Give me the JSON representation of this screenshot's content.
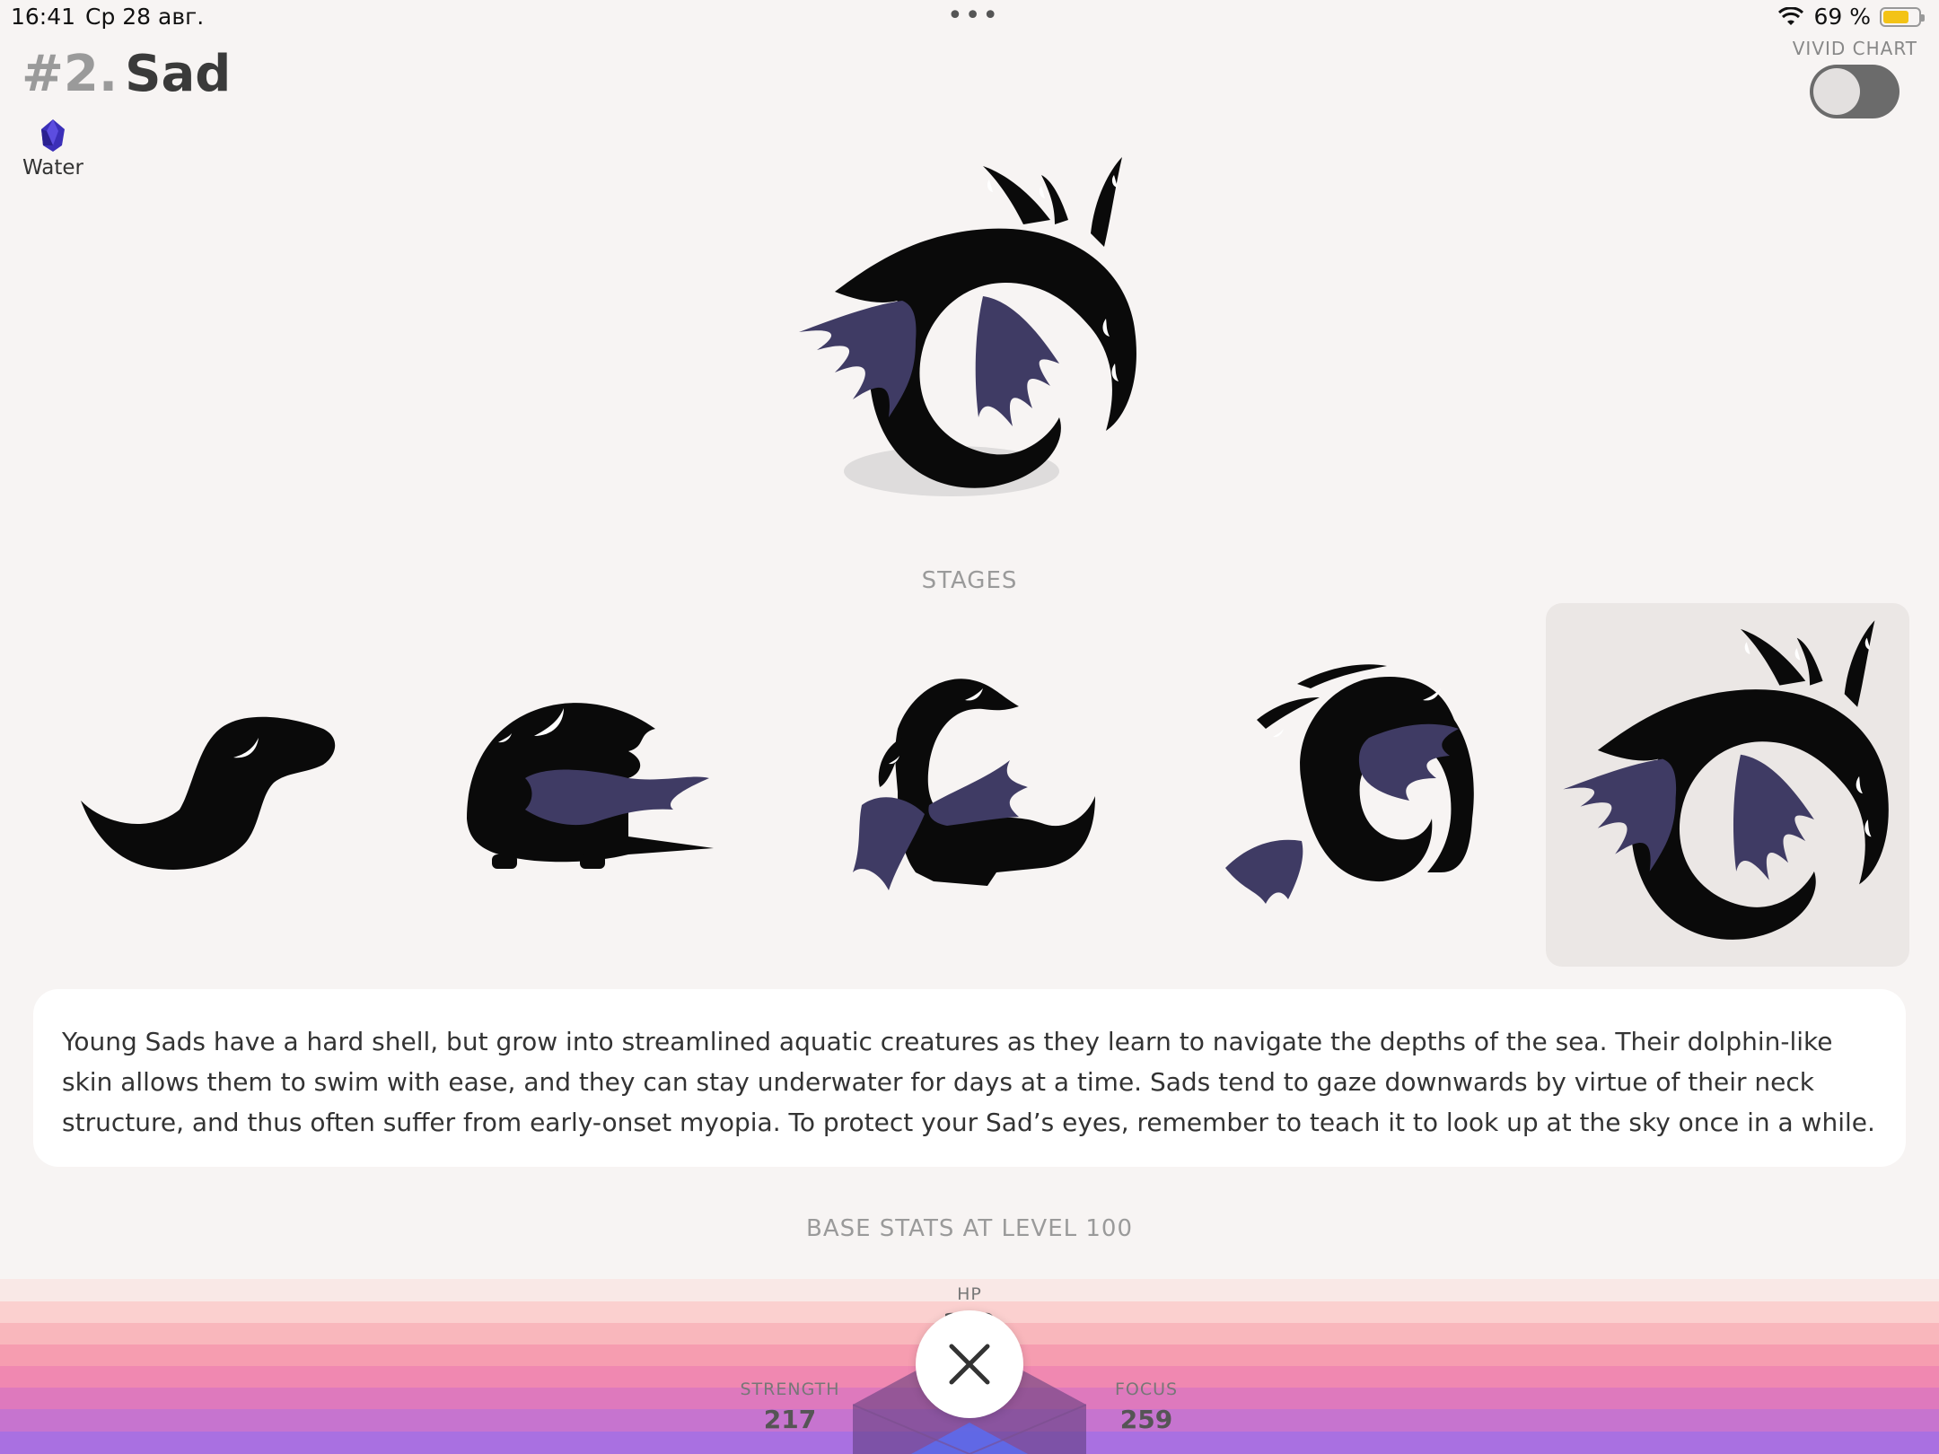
{
  "status": {
    "time": "16:41",
    "date": "Ср 28 авг.",
    "battery": "69 %",
    "dots": "•••"
  },
  "title": {
    "number": "#2.",
    "name": "Sad"
  },
  "element": {
    "label": "Water",
    "icon": "water-gem-icon"
  },
  "vivid_chart": {
    "label": "VIVID CHART",
    "enabled": false
  },
  "stages_label": "STAGES",
  "stages": [
    {
      "name": "stage-1",
      "selected": false
    },
    {
      "name": "stage-2",
      "selected": false
    },
    {
      "name": "stage-3",
      "selected": false
    },
    {
      "name": "stage-4",
      "selected": false
    },
    {
      "name": "stage-5",
      "selected": true
    }
  ],
  "description": "Young Sads have a hard shell, but grow into streamlined aquatic creatures as they learn to navigate the depths of the sea. Their dolphin-like skin allows them to swim with ease, and they can stay underwater for days at a time. Sads tend to gaze downwards by virtue of their neck structure, and thus often suffer from early-onset myopia. To protect your Sad’s eyes, remember to teach it to look up at the sky once in a while.",
  "base_stats_label": "BASE STATS AT LEVEL 100",
  "stats": {
    "hp": {
      "label": "HP",
      "value": "259"
    },
    "strength": {
      "label": "STRENGTH",
      "value": "217"
    },
    "focus": {
      "label": "FOCUS",
      "value": "259"
    }
  },
  "colors": {
    "accent_purple": "#3f3b64",
    "creature": "#0a0a0a"
  }
}
